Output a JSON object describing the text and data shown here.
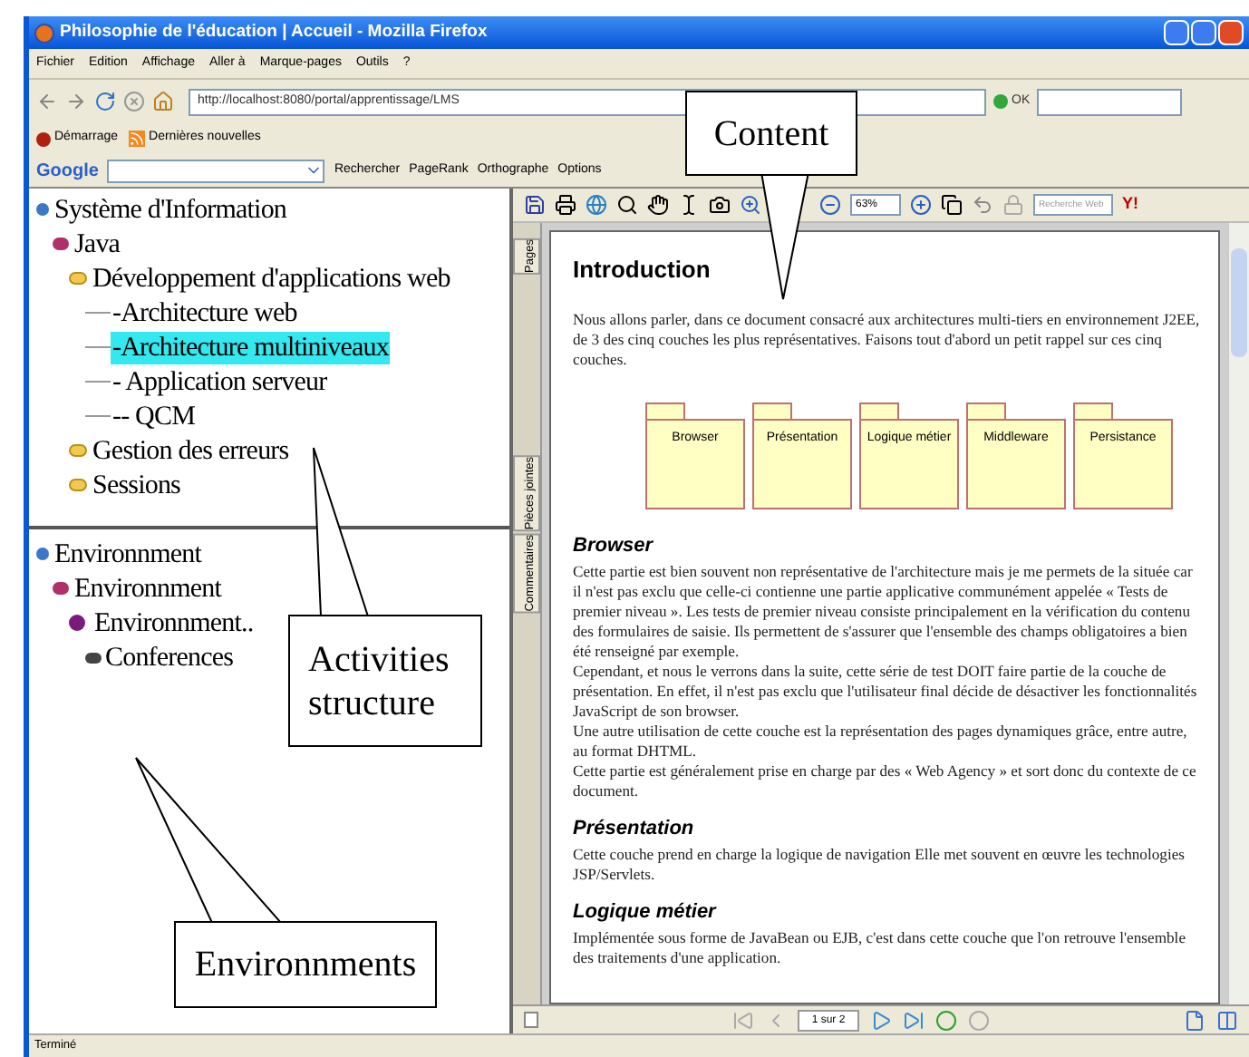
{
  "window": {
    "title": "Philosophie de l'éducation | Accueil - Mozilla Firefox"
  },
  "menu": [
    "Fichier",
    "Edition",
    "Affichage",
    "Aller à",
    "Marque-pages",
    "Outils",
    "?"
  ],
  "address": {
    "value": "http://localhost:8080/portal/apprentissage/LMS",
    "go": "OK"
  },
  "bookmarks": [
    "Démarrage",
    "Dernières nouvelles"
  ],
  "google_toolbar": {
    "logo": "Google",
    "items": [
      "Rechercher",
      "PageRank",
      "Orthographe",
      "Options"
    ]
  },
  "activities_tree": [
    {
      "label": "Système d'Information",
      "kind": "root",
      "selected": false,
      "children": [
        {
          "label": "Java",
          "kind": "course",
          "selected": false,
          "children": [
            {
              "label": "Développement d'applications web",
              "kind": "folder",
              "selected": false,
              "children": [
                {
                  "label": "-Architecture web",
                  "kind": "page",
                  "selected": false
                },
                {
                  "label": "-Architecture multiniveaux",
                  "kind": "page",
                  "selected": true
                },
                {
                  "label": "- Application serveur",
                  "kind": "page",
                  "selected": false
                },
                {
                  "label": "-- QCM",
                  "kind": "page",
                  "selected": false
                }
              ]
            },
            {
              "label": "Gestion des erreurs",
              "kind": "folder",
              "selected": false
            },
            {
              "label": "Sessions",
              "kind": "folder",
              "selected": false
            }
          ]
        }
      ]
    }
  ],
  "environments_tree": [
    {
      "label": "Environnment",
      "kind": "root",
      "selected": false,
      "children": [
        {
          "label": "Environnment",
          "kind": "course",
          "selected": false,
          "children": [
            {
              "label": "Environnment..",
              "kind": "env",
              "selected": false,
              "children": [
                {
                  "label": "Conferences",
                  "kind": "conference",
                  "selected": false
                }
              ]
            }
          ]
        }
      ]
    }
  ],
  "pdf_viewer": {
    "zoom": "63%",
    "search_placeholder": "Recherche Web",
    "search_logo": "Y!",
    "side_tabs": [
      "Pages",
      "Pièces jointes",
      "Commentaires"
    ],
    "page_indicator": "1 sur 2",
    "document": [
      {
        "kind": "heading",
        "text": "Introduction"
      },
      {
        "kind": "paragraph",
        "text": "Nous allons parler, dans ce document consacré aux architectures multi-tiers en environnement J2EE, de 3 des cinq couches les plus représentatives. Faisons tout d'abord un petit rappel sur ces cinq couches."
      },
      {
        "kind": "diagram",
        "items": [
          "Browser",
          "Présentation",
          "Logique métier",
          "Middleware",
          "Persistance"
        ]
      },
      {
        "kind": "heading",
        "text": "Browser"
      },
      {
        "kind": "paragraph",
        "text": "Cette partie est bien souvent non représentative de l'architecture mais je me permets de la située car il n'est pas exclu que celle-ci contienne une partie applicative communément appelée « Tests de premier niveau ». Les tests de premier niveau consiste principalement en la vérification du contenu des formulaires de saisie. Ils permettent de s'assurer que l'ensemble des champs obligatoires a bien été renseigné par exemple."
      },
      {
        "kind": "paragraph",
        "text": "Cependant, et nous le verrons dans la suite, cette série de test DOIT faire partie de la couche de présentation. En effet, il n'est pas exclu que l'utilisateur final décide de désactiver les fonctionnalités JavaScript de son browser."
      },
      {
        "kind": "paragraph",
        "text": "Une autre utilisation de cette couche est la représentation des pages dynamiques grâce, entre autre, au format DHTML."
      },
      {
        "kind": "paragraph",
        "text": "Cette partie est généralement prise en charge par des « Web Agency » et sort donc du contexte de ce document."
      },
      {
        "kind": "heading",
        "text": "Présentation"
      },
      {
        "kind": "paragraph",
        "text": "Cette couche prend en charge la logique de navigation Elle met souvent en œuvre les technologies JSP/Servlets."
      },
      {
        "kind": "heading",
        "text": "Logique métier"
      },
      {
        "kind": "paragraph",
        "text": "Implémentée sous forme de JavaBean ou EJB, c'est dans cette couche que l'on retrouve l'ensemble des traitements d'une application."
      }
    ]
  },
  "status_bar": "Terminé",
  "callouts": [
    {
      "text": "Content"
    },
    {
      "text": "Activities structure"
    },
    {
      "text": "Environnments"
    }
  ]
}
